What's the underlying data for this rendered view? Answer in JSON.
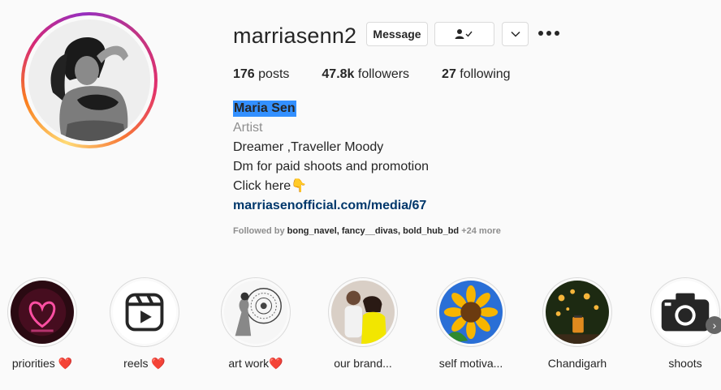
{
  "profile": {
    "username": "marriasenn2",
    "buttons": {
      "message": "Message",
      "follow_icon": "person-check-icon",
      "dropdown_icon": "chevron-down-icon"
    }
  },
  "stats": [
    {
      "count": "176",
      "label": "posts"
    },
    {
      "count": "47.8k",
      "label": "followers"
    },
    {
      "count": "27",
      "label": "following"
    }
  ],
  "bio": {
    "name": "Maria Sen",
    "category": "Artist",
    "line1": "Dreamer ,Traveller Moody",
    "line2": "Dm for paid shoots and promotion",
    "line3": "Click here👇",
    "link": "marriasenofficial.com/media/67"
  },
  "followed_by": {
    "prefix": "Followed by",
    "users": [
      "bong_navel",
      "fancy__divas",
      "bold_hub_bd"
    ],
    "more": "+24 more"
  },
  "highlights": [
    {
      "label": "priorities ❤️",
      "icon": "neon-heart"
    },
    {
      "label": "reels ❤️",
      "icon": "reels-icon"
    },
    {
      "label": "art work❤️",
      "icon": "mandala-art"
    },
    {
      "label": "our brand...",
      "icon": "couple-photo"
    },
    {
      "label": "self motiva...",
      "icon": "sunflower"
    },
    {
      "label": "Chandigarh",
      "icon": "lanterns"
    },
    {
      "label": "shoots",
      "icon": "camera-icon"
    }
  ],
  "colors": {
    "link": "#00376b",
    "name_highlight": "#3390ff",
    "muted": "#8e8e8e"
  }
}
